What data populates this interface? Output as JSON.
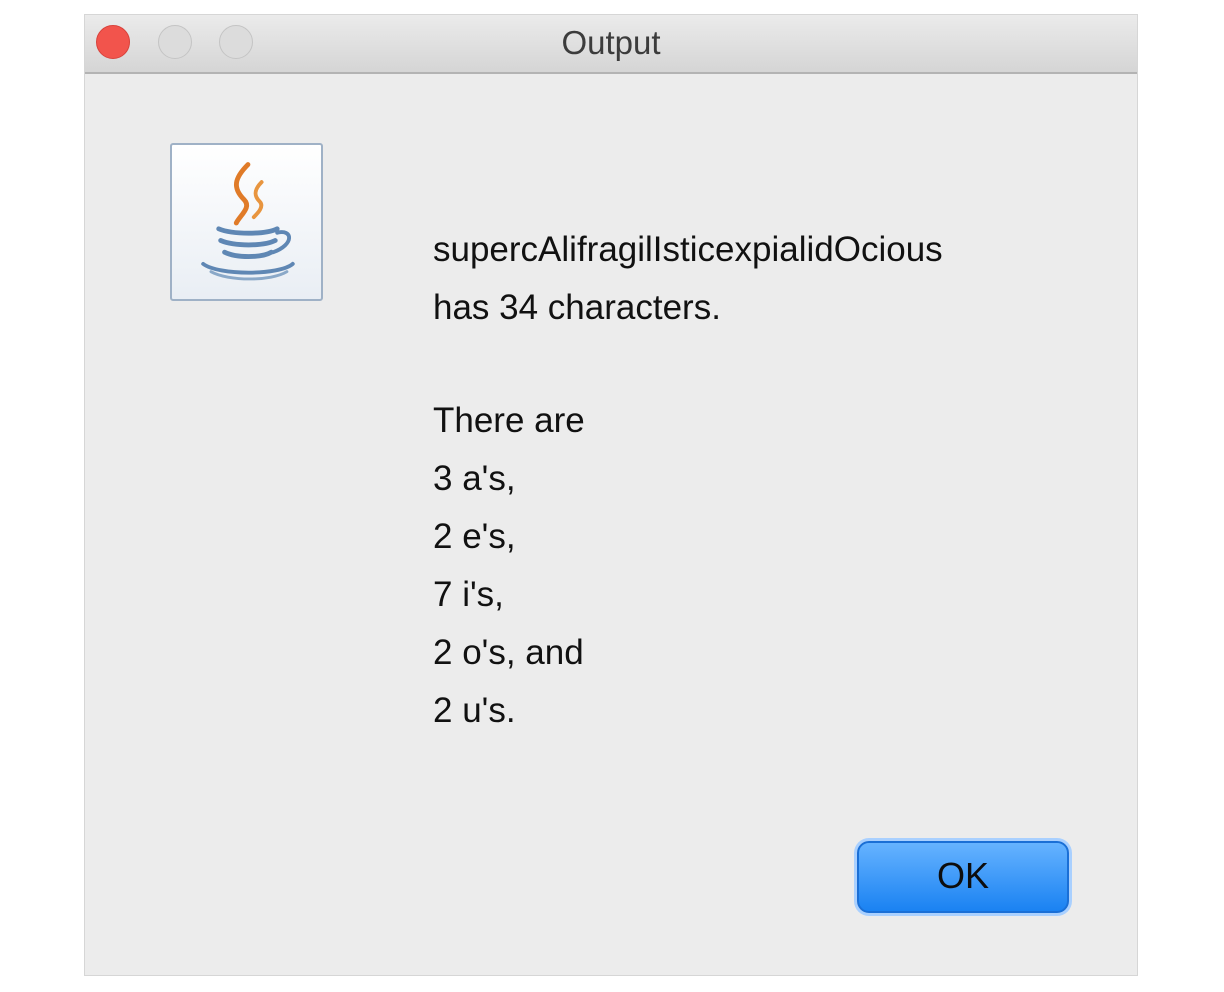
{
  "window": {
    "title": "Output"
  },
  "icon": {
    "name": "java-icon"
  },
  "message": {
    "word": "supercAlifragilIsticexpialidOcious",
    "length_line": "has 34 characters.",
    "intro": "There are",
    "counts": [
      "3 a's,",
      "2 e's,",
      "7 i's,",
      "2 o's, and",
      "2 u's."
    ]
  },
  "buttons": {
    "ok_label": "OK"
  },
  "colors": {
    "close_button": "#f2544c",
    "ok_button": "#1a82f2",
    "window_bg": "#ececec"
  }
}
